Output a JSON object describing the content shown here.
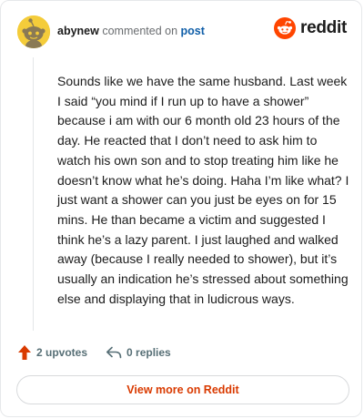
{
  "comment": {
    "username": "abynew",
    "action_text": "commented on",
    "post_link": "post",
    "body": "Sounds like we have the same husband. Last week I said “you mind if I run up to have a shower” because i am with our 6 month old 23 hours of the day. He reacted that I don’t need to ask him to watch his own son and to stop treating him like he doesn’t know what he’s doing. Haha I’m like what? I just want a shower can you just be eyes on for 15 mins. He than became a victim and suggested I think he’s a lazy parent. I just laughed and walked away (because I really needed to shower), but it’s usually an indication he’s stressed about something else and displaying that in ludicrous ways."
  },
  "brand": {
    "name": "reddit",
    "icon": "reddit-logo-icon",
    "color": "#ff4500"
  },
  "actions": {
    "upvotes": "2 upvotes",
    "upvote_icon": "upvote-arrow-icon",
    "replies": "0 replies",
    "reply_icon": "reply-arrow-icon"
  },
  "footer": {
    "view_more": "View more on Reddit"
  },
  "colors": {
    "accent": "#d93a00",
    "avatar_bg": "#f4cc3a",
    "link": "#0f5ea8",
    "meta": "#576f76"
  }
}
